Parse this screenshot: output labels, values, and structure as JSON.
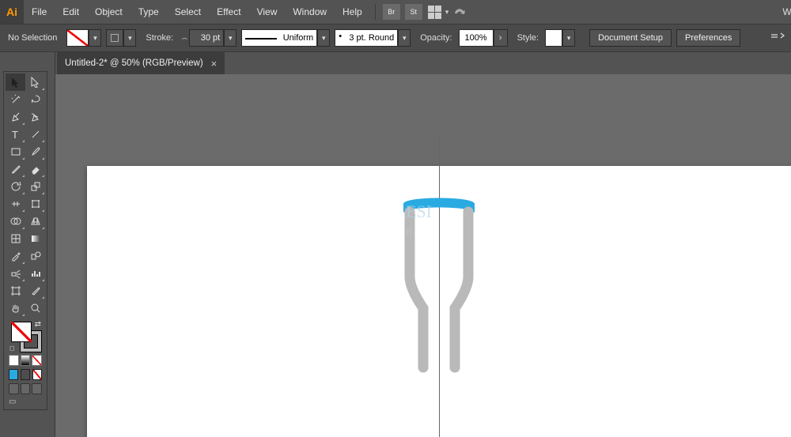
{
  "app": {
    "logo": "Ai"
  },
  "menu": {
    "file": "File",
    "edit": "Edit",
    "object": "Object",
    "type": "Type",
    "select": "Select",
    "effect": "Effect",
    "view": "View",
    "window": "Window",
    "help": "Help",
    "br_icon": "Br",
    "st_icon": "St"
  },
  "control": {
    "no_selection": "No Selection",
    "stroke_label": "Stroke:",
    "stroke_weight": "30 pt",
    "profile": "Uniform",
    "brush": "3 pt. Round",
    "opacity_label": "Opacity:",
    "opacity_value": "100%",
    "style_label": "Style:",
    "doc_setup": "Document Setup",
    "preferences": "Preferences"
  },
  "tab": {
    "title": "Untitled-2* @ 50% (RGB/Preview)",
    "close": "×"
  },
  "tools": {},
  "swatches": {
    "c1": "#29abe2",
    "c2": "#4d4d4d",
    "none": "none"
  },
  "right_edge": "W"
}
